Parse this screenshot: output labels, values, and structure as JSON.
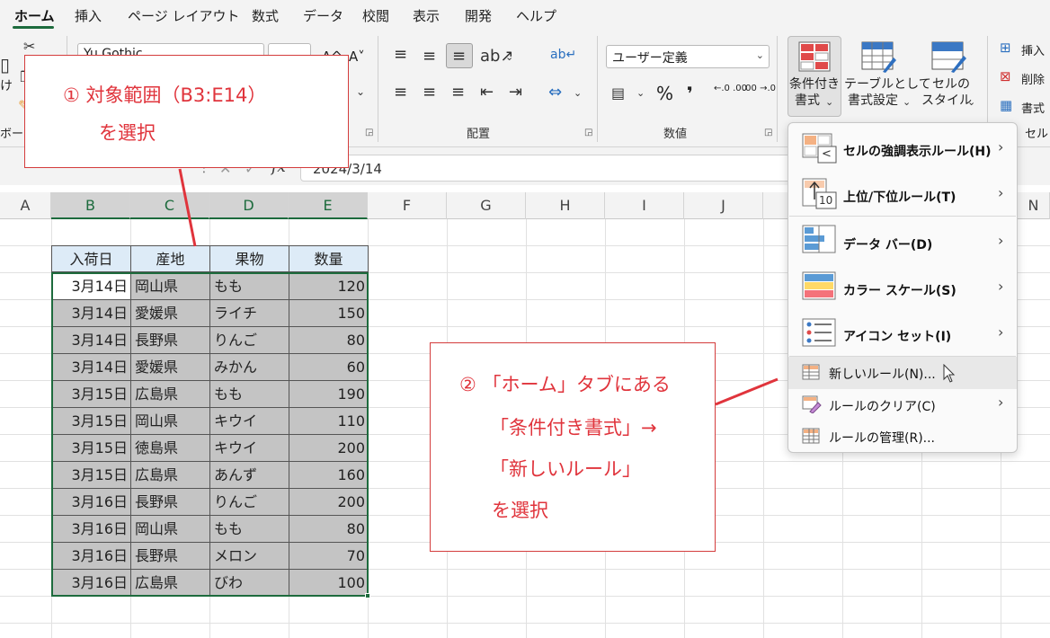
{
  "tabs": [
    "ホーム",
    "挿入",
    "ページ レイアウト",
    "数式",
    "データ",
    "校閲",
    "表示",
    "開発",
    "ヘルプ"
  ],
  "ribbon": {
    "paste_partial": "け",
    "clipboard_partial": "ボー",
    "font_name_partial": "Yu Gothic",
    "alignment_label": "配置",
    "number_label": "数値",
    "number_format": "ユーザー定義",
    "percent": "%",
    "comma": "❜",
    "increase_decimal": "←.0 .00",
    "decrease_decimal": ".00 →.0",
    "conditional_formatting_line1": "条件付き",
    "conditional_formatting_line2": "書式",
    "format_as_table_line1": "テーブルとして",
    "format_as_table_line2": "書式設定",
    "cell_styles_line1": "セルの",
    "cell_styles_line2": "スタイル",
    "insert_label": "挿入",
    "delete_label": "削除",
    "format_label": "書式",
    "cells_label_partial": "セル"
  },
  "formula_bar": {
    "cancel": "✕",
    "enter": "✓",
    "fx": "fx",
    "value": "2024/3/14"
  },
  "columns": [
    "A",
    "B",
    "C",
    "D",
    "E",
    "F",
    "G",
    "H",
    "I",
    "J",
    "N"
  ],
  "table": {
    "headers": [
      "入荷日",
      "産地",
      "果物",
      "数量"
    ],
    "rows": [
      [
        "3月14日",
        "岡山県",
        "もも",
        "120"
      ],
      [
        "3月14日",
        "愛媛県",
        "ライチ",
        "150"
      ],
      [
        "3月14日",
        "長野県",
        "りんご",
        "80"
      ],
      [
        "3月14日",
        "愛媛県",
        "みかん",
        "60"
      ],
      [
        "3月15日",
        "広島県",
        "もも",
        "190"
      ],
      [
        "3月15日",
        "岡山県",
        "キウイ",
        "110"
      ],
      [
        "3月15日",
        "徳島県",
        "キウイ",
        "200"
      ],
      [
        "3月15日",
        "広島県",
        "あんず",
        "160"
      ],
      [
        "3月16日",
        "長野県",
        "りんご",
        "200"
      ],
      [
        "3月16日",
        "岡山県",
        "もも",
        "80"
      ],
      [
        "3月16日",
        "長野県",
        "メロン",
        "70"
      ],
      [
        "3月16日",
        "広島県",
        "びわ",
        "100"
      ]
    ]
  },
  "callout1": {
    "line1": "① 対象範囲（B3:E14）",
    "line2": "を選択"
  },
  "callout2": {
    "line1": "② 「ホーム」タブにある",
    "line2": "「条件付き書式」→",
    "line3": "「新しいルール」",
    "line4": "を選択"
  },
  "menu": {
    "highlight_rules": "セルの強調表示ルール(H)",
    "top_bottom_rules": "上位/下位ルール(T)",
    "data_bars": "データ バー(D)",
    "color_scales": "カラー スケール(S)",
    "icon_sets": "アイコン セット(I)",
    "new_rule": "新しいルール(N)...",
    "clear_rules": "ルールのクリア(C)",
    "manage_rules": "ルールの管理(R)...",
    "top10_badge": "10",
    "less_than_badge": "<"
  },
  "colors": {
    "excel_green": "#1d6b3d",
    "header_fill": "#ddebf7",
    "selected_fill": "#c4c4c4",
    "callout_red": "#e0343c"
  }
}
